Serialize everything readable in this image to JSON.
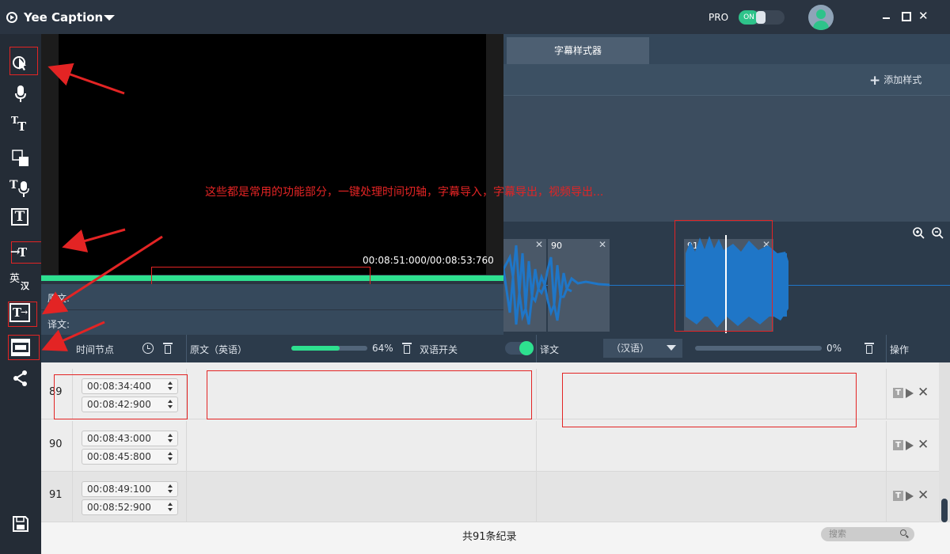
{
  "app": {
    "title": "Yee Caption",
    "pro_label": "PRO",
    "pro_toggle": "ON"
  },
  "preview": {
    "timecode": "00:08:51:000/00:08:53:760",
    "progress": 1.0
  },
  "subtitle_rows": {
    "original_label": "原文:",
    "translation_label": "译文:"
  },
  "style_panel": {
    "tab": "字幕样式器",
    "add_style": "添加样式"
  },
  "waveform": {
    "segments": [
      "",
      "90",
      "91"
    ]
  },
  "annotation": "这些都是常用的功能部分，一键处理时间切轴，字幕导入，字幕导出，视频导出...",
  "table": {
    "col_time": "时间节点",
    "col_original": "原文（英语）",
    "original_progress_text": "64%",
    "original_progress": 0.64,
    "bilingual": "双语开关",
    "col_translation": "译文",
    "lang": "（汉语）",
    "translation_progress_text": "0%",
    "translation_progress": 0,
    "col_ops": "操作",
    "rows": [
      {
        "num": "89",
        "start": "00:08:34:400",
        "end": "00:08:42:900"
      },
      {
        "num": "90",
        "start": "00:08:43:000",
        "end": "00:08:45:800"
      },
      {
        "num": "91",
        "start": "00:08:49:100",
        "end": "00:08:52:900"
      }
    ]
  },
  "footer": {
    "record_count": "共91条纪录",
    "search_placeholder": "搜索"
  },
  "toolbar": {
    "tool_text": "T",
    "tool_en": "英",
    "tool_cn": "汉",
    "op_text": "T"
  },
  "colors": {
    "accent": "#2ee08f",
    "highlight": "#e32424",
    "wave": "#1f76c7"
  }
}
